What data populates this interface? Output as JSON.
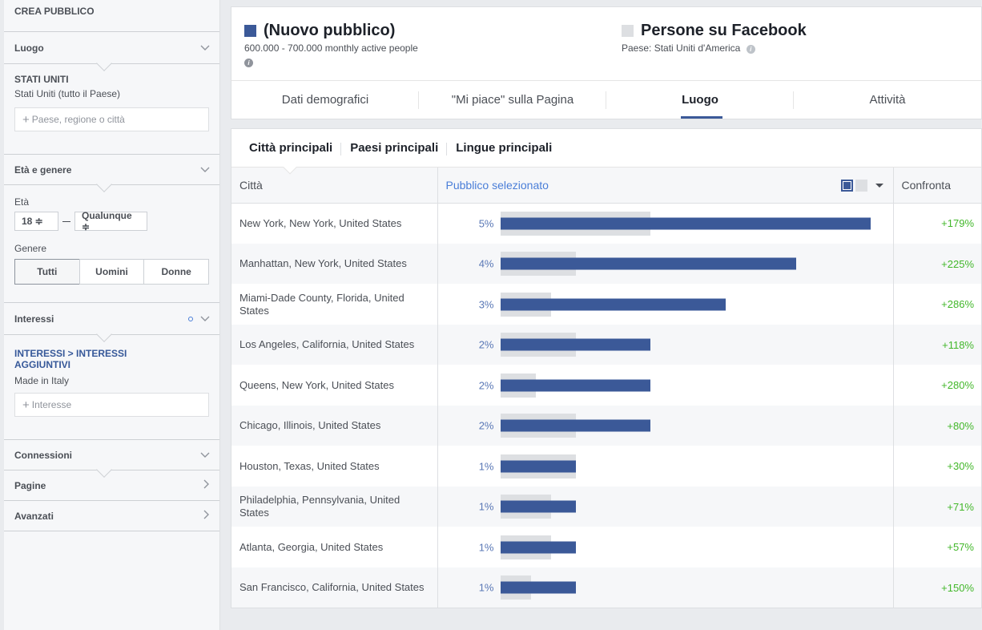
{
  "sidebar": {
    "title": "CREA PUBBLICO",
    "location": {
      "header": "Luogo",
      "country_caption": "STATI UNITI",
      "country_sub": "Stati Uniti (tutto il Paese)",
      "input_placeholder": "Paese, regione o città"
    },
    "age_gender": {
      "header": "Età e genere",
      "age_label": "Età",
      "age_min": "18 ≑",
      "age_max": "Qualunque ≑",
      "gender_label": "Genere",
      "gender_options": [
        "Tutti",
        "Uomini",
        "Donne"
      ]
    },
    "interests": {
      "header": "Interessi",
      "path": "INTERESSI > INTERESSI AGGIUNTIVI",
      "selected": "Made in Italy",
      "input_placeholder": "Interesse"
    },
    "connections": {
      "header": "Connessioni"
    },
    "pages": {
      "header": "Pagine"
    },
    "advanced": {
      "header": "Avanzati"
    }
  },
  "header": {
    "audience": {
      "title": "(Nuovo pubblico)",
      "subtitle": "600.000 - 700.000 monthly active people",
      "color": "#3b5998"
    },
    "comparison": {
      "title": "Persone su Facebook",
      "subtitle": "Paese: Stati Uniti d'America",
      "color": "#dddfe2"
    }
  },
  "tabs": [
    "Dati demografici",
    "\"Mi piace\" sulla Pagina",
    "Luogo",
    "Attività"
  ],
  "subtabs": [
    "Città principali",
    "Paesi principali",
    "Lingue principali"
  ],
  "table": {
    "col_city": "Città",
    "col_selected": "Pubblico selezionato",
    "col_compare": "Confronta",
    "rows": [
      {
        "city": "New York, New York, United States",
        "pct": "5%",
        "compare": "+179%"
      },
      {
        "city": "Manhattan, New York, United States",
        "pct": "4%",
        "compare": "+225%"
      },
      {
        "city": "Miami-Dade County, Florida, United States",
        "pct": "3%",
        "compare": "+286%"
      },
      {
        "city": "Los Angeles, California, United States",
        "pct": "2%",
        "compare": "+118%"
      },
      {
        "city": "Queens, New York, United States",
        "pct": "2%",
        "compare": "+280%"
      },
      {
        "city": "Chicago, Illinois, United States",
        "pct": "2%",
        "compare": "+80%"
      },
      {
        "city": "Houston, Texas, United States",
        "pct": "1%",
        "compare": "+30%"
      },
      {
        "city": "Philadelphia, Pennsylvania, United States",
        "pct": "1%",
        "compare": "+71%"
      },
      {
        "city": "Atlanta, Georgia, United States",
        "pct": "1%",
        "compare": "+57%"
      },
      {
        "city": "San Francisco, California, United States",
        "pct": "1%",
        "compare": "+150%"
      }
    ]
  }
}
